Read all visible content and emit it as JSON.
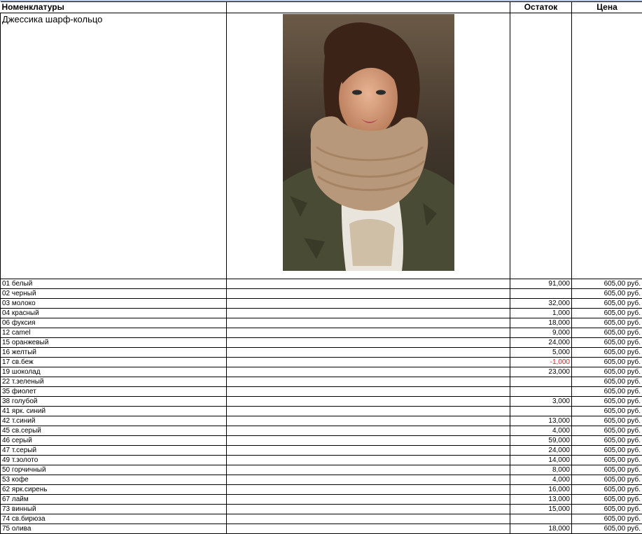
{
  "header": {
    "col1": "Номенклатуры",
    "col3": "Остаток",
    "col4": "Цена"
  },
  "product": {
    "name": "Джессика шарф-кольцо",
    "photo_icon": "model-photo"
  },
  "rows": [
    {
      "name": "01 белый",
      "stock": "91,000",
      "price": "605,00 руб."
    },
    {
      "name": "02 черный",
      "stock": "",
      "price": "605,00 руб."
    },
    {
      "name": "03 молоко",
      "stock": "32,000",
      "price": "605,00 руб."
    },
    {
      "name": "04 красный",
      "stock": "1,000",
      "price": "605,00 руб."
    },
    {
      "name": "06 фуксия",
      "stock": "18,000",
      "price": "605,00 руб."
    },
    {
      "name": "12 camel",
      "stock": "9,000",
      "price": "605,00 руб."
    },
    {
      "name": "15 оранжевый",
      "stock": "24,000",
      "price": "605,00 руб."
    },
    {
      "name": "16 желтый",
      "stock": "5,000",
      "price": "605,00 руб."
    },
    {
      "name": "17 св.беж",
      "stock": "-1,000",
      "price": "605,00 руб."
    },
    {
      "name": "19 шоколад",
      "stock": "23,000",
      "price": "605,00 руб."
    },
    {
      "name": "22 т.зеленый",
      "stock": "",
      "price": "605,00 руб."
    },
    {
      "name": "35 фиолет",
      "stock": "",
      "price": "605,00 руб."
    },
    {
      "name": "38 голубой",
      "stock": "3,000",
      "price": "605,00 руб."
    },
    {
      "name": "41 ярк. синий",
      "stock": "",
      "price": "605,00 руб."
    },
    {
      "name": "42 т.синий",
      "stock": "13,000",
      "price": "605,00 руб."
    },
    {
      "name": "45 св.серый",
      "stock": "4,000",
      "price": "605,00 руб."
    },
    {
      "name": "46 серый",
      "stock": "59,000",
      "price": "605,00 руб."
    },
    {
      "name": "47 т.серый",
      "stock": "24,000",
      "price": "605,00 руб."
    },
    {
      "name": "49 т.золото",
      "stock": "14,000",
      "price": "605,00 руб."
    },
    {
      "name": "50 горчичный",
      "stock": "8,000",
      "price": "605,00 руб."
    },
    {
      "name": "53 кофе",
      "stock": "4,000",
      "price": "605,00 руб."
    },
    {
      "name": "62 ярк.сирень",
      "stock": "16,000",
      "price": "605,00 руб."
    },
    {
      "name": "67 лайм",
      "stock": "13,000",
      "price": "605,00 руб."
    },
    {
      "name": "73 винный",
      "stock": "15,000",
      "price": "605,00 руб."
    },
    {
      "name": "74 св.бирюза",
      "stock": "",
      "price": "605,00 руб."
    },
    {
      "name": "75 олива",
      "stock": "18,000",
      "price": "605,00 руб."
    }
  ],
  "colors": {
    "negative": "#e0192e",
    "grid": "#000000"
  }
}
